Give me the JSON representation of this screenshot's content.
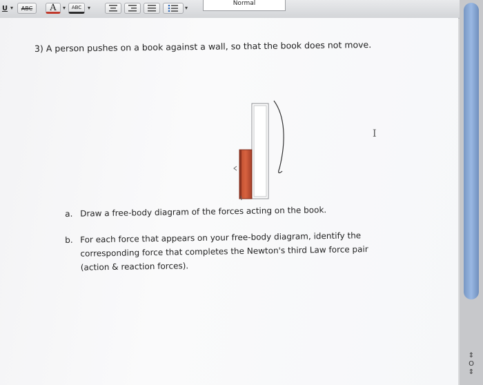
{
  "toolbar": {
    "underline_label": "U",
    "strike_label": "ABC",
    "font_color_label": "A",
    "highlight_label": "ABC",
    "style_value": "Normal",
    "colors": {
      "accent": "#c0392b",
      "highlight": "#2b2b2b"
    }
  },
  "document": {
    "question_title": "3) A person pushes on a book against a wall, so that the book does not move.",
    "items": [
      {
        "letter": "a.",
        "lines": [
          "Draw a free-body diagram of the forces acting on the book."
        ]
      },
      {
        "letter": "b.",
        "lines": [
          "For each force that appears on your free-body diagram, identify the",
          "corresponding force that completes the Newton's third Law force pair",
          "(action & reaction forces)."
        ]
      }
    ],
    "cursor_glyph": "I"
  },
  "scrollbar": {
    "glyph": "⇕ O ⇕"
  },
  "icons": [
    "underline-icon",
    "strikethrough-icon",
    "font-color-icon",
    "highlight-icon",
    "align-center-icon",
    "align-right-icon",
    "justify-icon",
    "list-icon",
    "text-cursor-icon"
  ]
}
